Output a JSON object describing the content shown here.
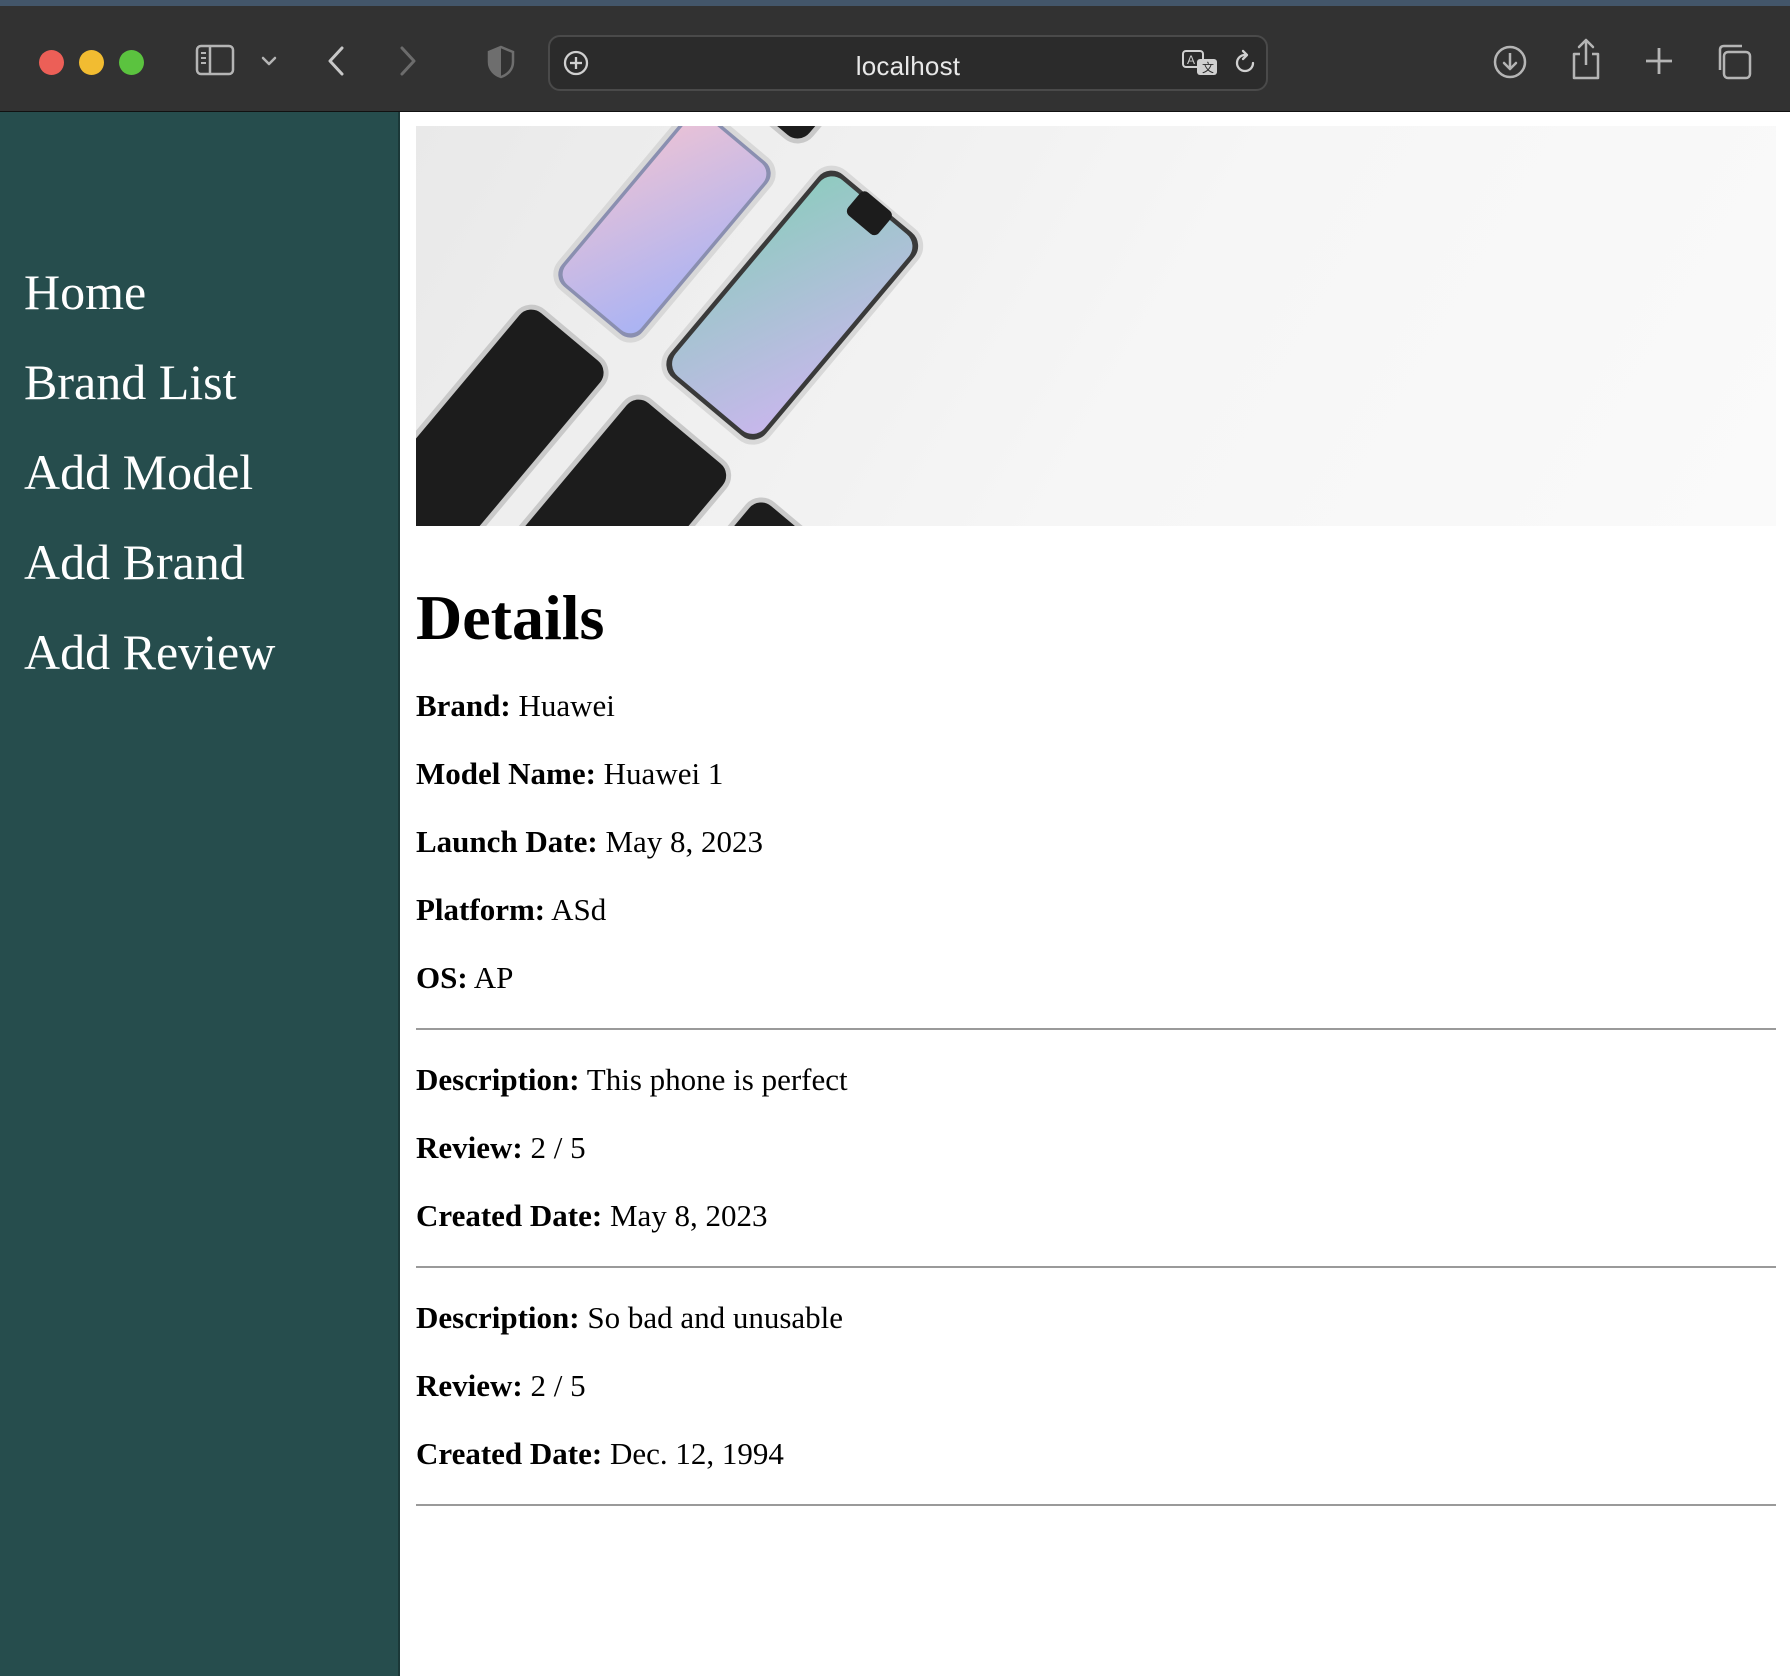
{
  "browser": {
    "url": "localhost",
    "icons": [
      "sidebar-toggle-icon",
      "chevron-down-icon",
      "back-icon",
      "forward-icon",
      "shield-icon",
      "site-settings-icon",
      "translate-icon",
      "reload-icon",
      "download-icon",
      "share-icon",
      "new-tab-icon",
      "tab-overview-icon"
    ]
  },
  "sidebar": {
    "items": [
      {
        "label": "Home"
      },
      {
        "label": "Brand List"
      },
      {
        "label": "Add Model"
      },
      {
        "label": "Add Brand"
      },
      {
        "label": "Add Review"
      }
    ]
  },
  "main": {
    "title": "Details",
    "specs": [
      {
        "label": "Brand:",
        "value": "Huawei"
      },
      {
        "label": "Model Name:",
        "value": "Huawei 1"
      },
      {
        "label": "Launch Date:",
        "value": "May 8, 2023"
      },
      {
        "label": "Platform:",
        "value": "ASd"
      },
      {
        "label": "OS:",
        "value": "AP"
      }
    ],
    "reviews": [
      {
        "description_label": "Description:",
        "description": "This phone is perfect",
        "review_label": "Review:",
        "review": "2 / 5",
        "created_label": "Created Date:",
        "created": "May 8, 2023"
      },
      {
        "description_label": "Description:",
        "description": "So bad and unusable",
        "review_label": "Review:",
        "review": "2 / 5",
        "created_label": "Created Date:",
        "created": "Dec. 12, 1994"
      }
    ]
  },
  "colors": {
    "sidebar_bg": "#264d4d",
    "titlebar_bg": "#323232",
    "close": "#ec5f57",
    "minimize": "#f2bc31",
    "zoom": "#5bc33f"
  }
}
